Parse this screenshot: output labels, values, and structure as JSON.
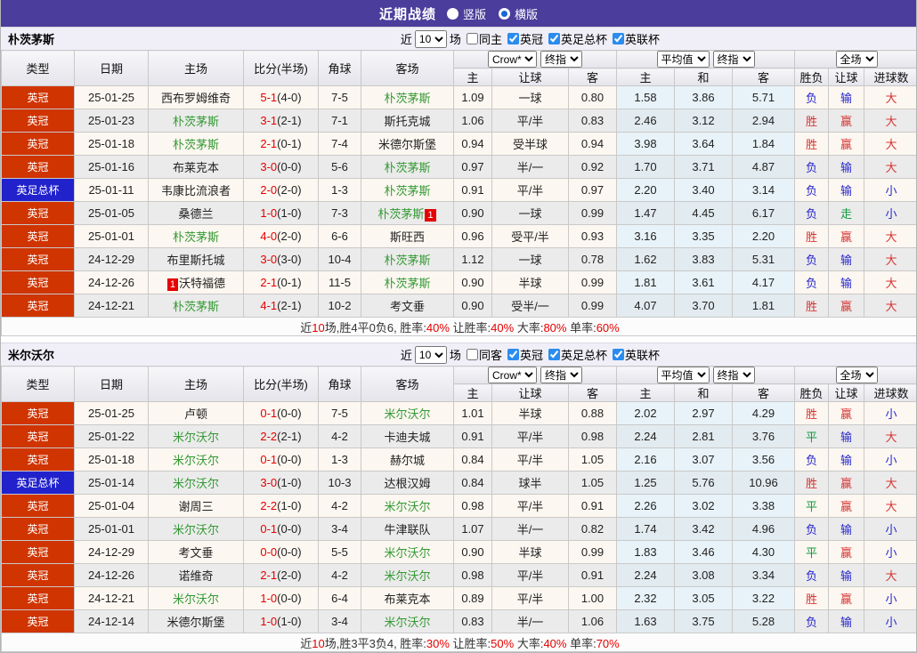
{
  "titlebar": {
    "title": "近期战绩",
    "radios": [
      {
        "label": "竖版",
        "selected": false
      },
      {
        "label": "横版",
        "selected": true
      }
    ]
  },
  "column_headers": {
    "main": [
      "类型",
      "日期",
      "主场",
      "比分(半场)",
      "角球",
      "客场"
    ],
    "sub": [
      "主",
      "让球",
      "客",
      "主",
      "和",
      "客",
      "胜负",
      "让球",
      "进球数"
    ]
  },
  "colors": {
    "titlebar_bg": "#4a3d9b",
    "league_badge": "#d03400",
    "cup_badge": "#2222cc",
    "focus_team": "#339933",
    "win_red": "#d63434",
    "lose_blue": "#2727cf",
    "draw_green": "#0f9a3c",
    "score_red": "#e60000"
  },
  "result_color_map": {
    "red": [
      "胜",
      "赢",
      "大"
    ],
    "green": [
      "平",
      "走"
    ],
    "blue": [
      "负",
      "输",
      "小"
    ]
  },
  "tables": [
    {
      "team": "朴茨茅斯",
      "filters": {
        "prefix": "近",
        "matches": "10",
        "suffix": "场",
        "venue": {
          "label": "同主",
          "checked": false
        },
        "cups": [
          {
            "label": "英冠",
            "checked": true
          },
          {
            "label": "英足总杯",
            "checked": true
          },
          {
            "label": "英联杯",
            "checked": true
          }
        ]
      },
      "selects": {
        "odds_source": "Crow*",
        "odds_final": "终指",
        "avg": "平均值",
        "avg_final": "终指",
        "scope": "全场"
      },
      "rows": [
        {
          "comp": "英冠",
          "cup": false,
          "date": "25-01-25",
          "home": {
            "name": "西布罗姆维奇",
            "focus": false
          },
          "score": {
            "ft": "5-1",
            "ht": "(4-0)"
          },
          "corners": "7-5",
          "away": {
            "name": "朴茨茅斯",
            "focus": true
          },
          "odds": [
            "1.09",
            "一球",
            "0.80"
          ],
          "avg": [
            "1.58",
            "3.86",
            "5.71"
          ],
          "results": [
            "负",
            "输",
            "大"
          ]
        },
        {
          "comp": "英冠",
          "cup": false,
          "date": "25-01-23",
          "home": {
            "name": "朴茨茅斯",
            "focus": true
          },
          "score": {
            "ft": "3-1",
            "ht": "(2-1)"
          },
          "corners": "7-1",
          "away": {
            "name": "斯托克城",
            "focus": false
          },
          "odds": [
            "1.06",
            "平/半",
            "0.83"
          ],
          "avg": [
            "2.46",
            "3.12",
            "2.94"
          ],
          "results": [
            "胜",
            "赢",
            "大"
          ]
        },
        {
          "comp": "英冠",
          "cup": false,
          "date": "25-01-18",
          "home": {
            "name": "朴茨茅斯",
            "focus": true
          },
          "score": {
            "ft": "2-1",
            "ht": "(0-1)"
          },
          "corners": "7-4",
          "away": {
            "name": "米德尔斯堡",
            "focus": false
          },
          "odds": [
            "0.94",
            "受半球",
            "0.94"
          ],
          "avg": [
            "3.98",
            "3.64",
            "1.84"
          ],
          "results": [
            "胜",
            "赢",
            "大"
          ]
        },
        {
          "comp": "英冠",
          "cup": false,
          "date": "25-01-16",
          "home": {
            "name": "布莱克本",
            "focus": false
          },
          "score": {
            "ft": "3-0",
            "ht": "(0-0)"
          },
          "corners": "5-6",
          "away": {
            "name": "朴茨茅斯",
            "focus": true
          },
          "odds": [
            "0.97",
            "半/一",
            "0.92"
          ],
          "avg": [
            "1.70",
            "3.71",
            "4.87"
          ],
          "results": [
            "负",
            "输",
            "大"
          ]
        },
        {
          "comp": "英足总杯",
          "cup": true,
          "date": "25-01-11",
          "home": {
            "name": "韦康比流浪者",
            "focus": false
          },
          "score": {
            "ft": "2-0",
            "ht": "(2-0)"
          },
          "corners": "1-3",
          "away": {
            "name": "朴茨茅斯",
            "focus": true
          },
          "odds": [
            "0.91",
            "平/半",
            "0.97"
          ],
          "avg": [
            "2.20",
            "3.40",
            "3.14"
          ],
          "results": [
            "负",
            "输",
            "小"
          ]
        },
        {
          "comp": "英冠",
          "cup": false,
          "date": "25-01-05",
          "home": {
            "name": "桑德兰",
            "focus": false
          },
          "score": {
            "ft": "1-0",
            "ht": "(1-0)"
          },
          "corners": "7-3",
          "away": {
            "name": "朴茨茅斯",
            "focus": true,
            "badge": "1",
            "badge_pos": "after"
          },
          "odds": [
            "0.90",
            "一球",
            "0.99"
          ],
          "avg": [
            "1.47",
            "4.45",
            "6.17"
          ],
          "results": [
            "负",
            "走",
            "小"
          ]
        },
        {
          "comp": "英冠",
          "cup": false,
          "date": "25-01-01",
          "home": {
            "name": "朴茨茅斯",
            "focus": true
          },
          "score": {
            "ft": "4-0",
            "ht": "(2-0)"
          },
          "corners": "6-6",
          "away": {
            "name": "斯旺西",
            "focus": false
          },
          "odds": [
            "0.96",
            "受平/半",
            "0.93"
          ],
          "avg": [
            "3.16",
            "3.35",
            "2.20"
          ],
          "results": [
            "胜",
            "赢",
            "大"
          ]
        },
        {
          "comp": "英冠",
          "cup": false,
          "date": "24-12-29",
          "home": {
            "name": "布里斯托城",
            "focus": false
          },
          "score": {
            "ft": "3-0",
            "ht": "(3-0)"
          },
          "corners": "10-4",
          "away": {
            "name": "朴茨茅斯",
            "focus": true
          },
          "odds": [
            "1.12",
            "一球",
            "0.78"
          ],
          "avg": [
            "1.62",
            "3.83",
            "5.31"
          ],
          "results": [
            "负",
            "输",
            "大"
          ]
        },
        {
          "comp": "英冠",
          "cup": false,
          "date": "24-12-26",
          "home": {
            "name": "沃特福德",
            "focus": false,
            "badge": "1",
            "badge_pos": "before"
          },
          "score": {
            "ft": "2-1",
            "ht": "(0-1)"
          },
          "corners": "11-5",
          "away": {
            "name": "朴茨茅斯",
            "focus": true
          },
          "odds": [
            "0.90",
            "半球",
            "0.99"
          ],
          "avg": [
            "1.81",
            "3.61",
            "4.17"
          ],
          "results": [
            "负",
            "输",
            "大"
          ]
        },
        {
          "comp": "英冠",
          "cup": false,
          "date": "24-12-21",
          "home": {
            "name": "朴茨茅斯",
            "focus": true
          },
          "score": {
            "ft": "4-1",
            "ht": "(2-1)"
          },
          "corners": "10-2",
          "away": {
            "name": "考文垂",
            "focus": false
          },
          "odds": [
            "0.90",
            "受半/一",
            "0.99"
          ],
          "avg": [
            "4.07",
            "3.70",
            "1.81"
          ],
          "results": [
            "胜",
            "赢",
            "大"
          ]
        }
      ],
      "summary": [
        [
          "近",
          false
        ],
        [
          "10",
          true
        ],
        [
          "场,胜4平0负6, 胜率:",
          false
        ],
        [
          "40%",
          true
        ],
        [
          " 让胜率:",
          false
        ],
        [
          "40%",
          true
        ],
        [
          " 大率:",
          false
        ],
        [
          "80%",
          true
        ],
        [
          " 单率:",
          false
        ],
        [
          "60%",
          true
        ]
      ]
    },
    {
      "team": "米尔沃尔",
      "filters": {
        "prefix": "近",
        "matches": "10",
        "suffix": "场",
        "venue": {
          "label": "同客",
          "checked": false
        },
        "cups": [
          {
            "label": "英冠",
            "checked": true
          },
          {
            "label": "英足总杯",
            "checked": true
          },
          {
            "label": "英联杯",
            "checked": true
          }
        ]
      },
      "selects": {
        "odds_source": "Crow*",
        "odds_final": "终指",
        "avg": "平均值",
        "avg_final": "终指",
        "scope": "全场"
      },
      "rows": [
        {
          "comp": "英冠",
          "cup": false,
          "date": "25-01-25",
          "home": {
            "name": "卢顿",
            "focus": false
          },
          "score": {
            "ft": "0-1",
            "ht": "(0-0)"
          },
          "corners": "7-5",
          "away": {
            "name": "米尔沃尔",
            "focus": true
          },
          "odds": [
            "1.01",
            "半球",
            "0.88"
          ],
          "avg": [
            "2.02",
            "2.97",
            "4.29"
          ],
          "results": [
            "胜",
            "赢",
            "小"
          ]
        },
        {
          "comp": "英冠",
          "cup": false,
          "date": "25-01-22",
          "home": {
            "name": "米尔沃尔",
            "focus": true
          },
          "score": {
            "ft": "2-2",
            "ht": "(2-1)"
          },
          "corners": "4-2",
          "away": {
            "name": "卡迪夫城",
            "focus": false
          },
          "odds": [
            "0.91",
            "平/半",
            "0.98"
          ],
          "avg": [
            "2.24",
            "2.81",
            "3.76"
          ],
          "results": [
            "平",
            "输",
            "大"
          ]
        },
        {
          "comp": "英冠",
          "cup": false,
          "date": "25-01-18",
          "home": {
            "name": "米尔沃尔",
            "focus": true
          },
          "score": {
            "ft": "0-1",
            "ht": "(0-0)"
          },
          "corners": "1-3",
          "away": {
            "name": "赫尔城",
            "focus": false
          },
          "odds": [
            "0.84",
            "平/半",
            "1.05"
          ],
          "avg": [
            "2.16",
            "3.07",
            "3.56"
          ],
          "results": [
            "负",
            "输",
            "小"
          ]
        },
        {
          "comp": "英足总杯",
          "cup": true,
          "date": "25-01-14",
          "home": {
            "name": "米尔沃尔",
            "focus": true
          },
          "score": {
            "ft": "3-0",
            "ht": "(1-0)"
          },
          "corners": "10-3",
          "away": {
            "name": "达根汉姆",
            "focus": false
          },
          "odds": [
            "0.84",
            "球半",
            "1.05"
          ],
          "avg": [
            "1.25",
            "5.76",
            "10.96"
          ],
          "results": [
            "胜",
            "赢",
            "大"
          ]
        },
        {
          "comp": "英冠",
          "cup": false,
          "date": "25-01-04",
          "home": {
            "name": "谢周三",
            "focus": false
          },
          "score": {
            "ft": "2-2",
            "ht": "(1-0)"
          },
          "corners": "4-2",
          "away": {
            "name": "米尔沃尔",
            "focus": true
          },
          "odds": [
            "0.98",
            "平/半",
            "0.91"
          ],
          "avg": [
            "2.26",
            "3.02",
            "3.38"
          ],
          "results": [
            "平",
            "赢",
            "大"
          ]
        },
        {
          "comp": "英冠",
          "cup": false,
          "date": "25-01-01",
          "home": {
            "name": "米尔沃尔",
            "focus": true
          },
          "score": {
            "ft": "0-1",
            "ht": "(0-0)"
          },
          "corners": "3-4",
          "away": {
            "name": "牛津联队",
            "focus": false
          },
          "odds": [
            "1.07",
            "半/一",
            "0.82"
          ],
          "avg": [
            "1.74",
            "3.42",
            "4.96"
          ],
          "results": [
            "负",
            "输",
            "小"
          ]
        },
        {
          "comp": "英冠",
          "cup": false,
          "date": "24-12-29",
          "home": {
            "name": "考文垂",
            "focus": false
          },
          "score": {
            "ft": "0-0",
            "ht": "(0-0)"
          },
          "corners": "5-5",
          "away": {
            "name": "米尔沃尔",
            "focus": true
          },
          "odds": [
            "0.90",
            "半球",
            "0.99"
          ],
          "avg": [
            "1.83",
            "3.46",
            "4.30"
          ],
          "results": [
            "平",
            "赢",
            "小"
          ]
        },
        {
          "comp": "英冠",
          "cup": false,
          "date": "24-12-26",
          "home": {
            "name": "诺维奇",
            "focus": false
          },
          "score": {
            "ft": "2-1",
            "ht": "(2-0)"
          },
          "corners": "4-2",
          "away": {
            "name": "米尔沃尔",
            "focus": true
          },
          "odds": [
            "0.98",
            "平/半",
            "0.91"
          ],
          "avg": [
            "2.24",
            "3.08",
            "3.34"
          ],
          "results": [
            "负",
            "输",
            "大"
          ]
        },
        {
          "comp": "英冠",
          "cup": false,
          "date": "24-12-21",
          "home": {
            "name": "米尔沃尔",
            "focus": true
          },
          "score": {
            "ft": "1-0",
            "ht": "(0-0)"
          },
          "corners": "6-4",
          "away": {
            "name": "布莱克本",
            "focus": false
          },
          "odds": [
            "0.89",
            "平/半",
            "1.00"
          ],
          "avg": [
            "2.32",
            "3.05",
            "3.22"
          ],
          "results": [
            "胜",
            "赢",
            "小"
          ]
        },
        {
          "comp": "英冠",
          "cup": false,
          "date": "24-12-14",
          "home": {
            "name": "米德尔斯堡",
            "focus": false
          },
          "score": {
            "ft": "1-0",
            "ht": "(1-0)"
          },
          "corners": "3-4",
          "away": {
            "name": "米尔沃尔",
            "focus": true
          },
          "odds": [
            "0.83",
            "半/一",
            "1.06"
          ],
          "avg": [
            "1.63",
            "3.75",
            "5.28"
          ],
          "results": [
            "负",
            "输",
            "小"
          ]
        }
      ],
      "summary": [
        [
          "近",
          false
        ],
        [
          "10",
          true
        ],
        [
          "场,胜3平3负4, 胜率:",
          false
        ],
        [
          "30%",
          true
        ],
        [
          " 让胜率:",
          false
        ],
        [
          "50%",
          true
        ],
        [
          " 大率:",
          false
        ],
        [
          "40%",
          true
        ],
        [
          " 单率:",
          false
        ],
        [
          "70%",
          true
        ]
      ]
    }
  ]
}
